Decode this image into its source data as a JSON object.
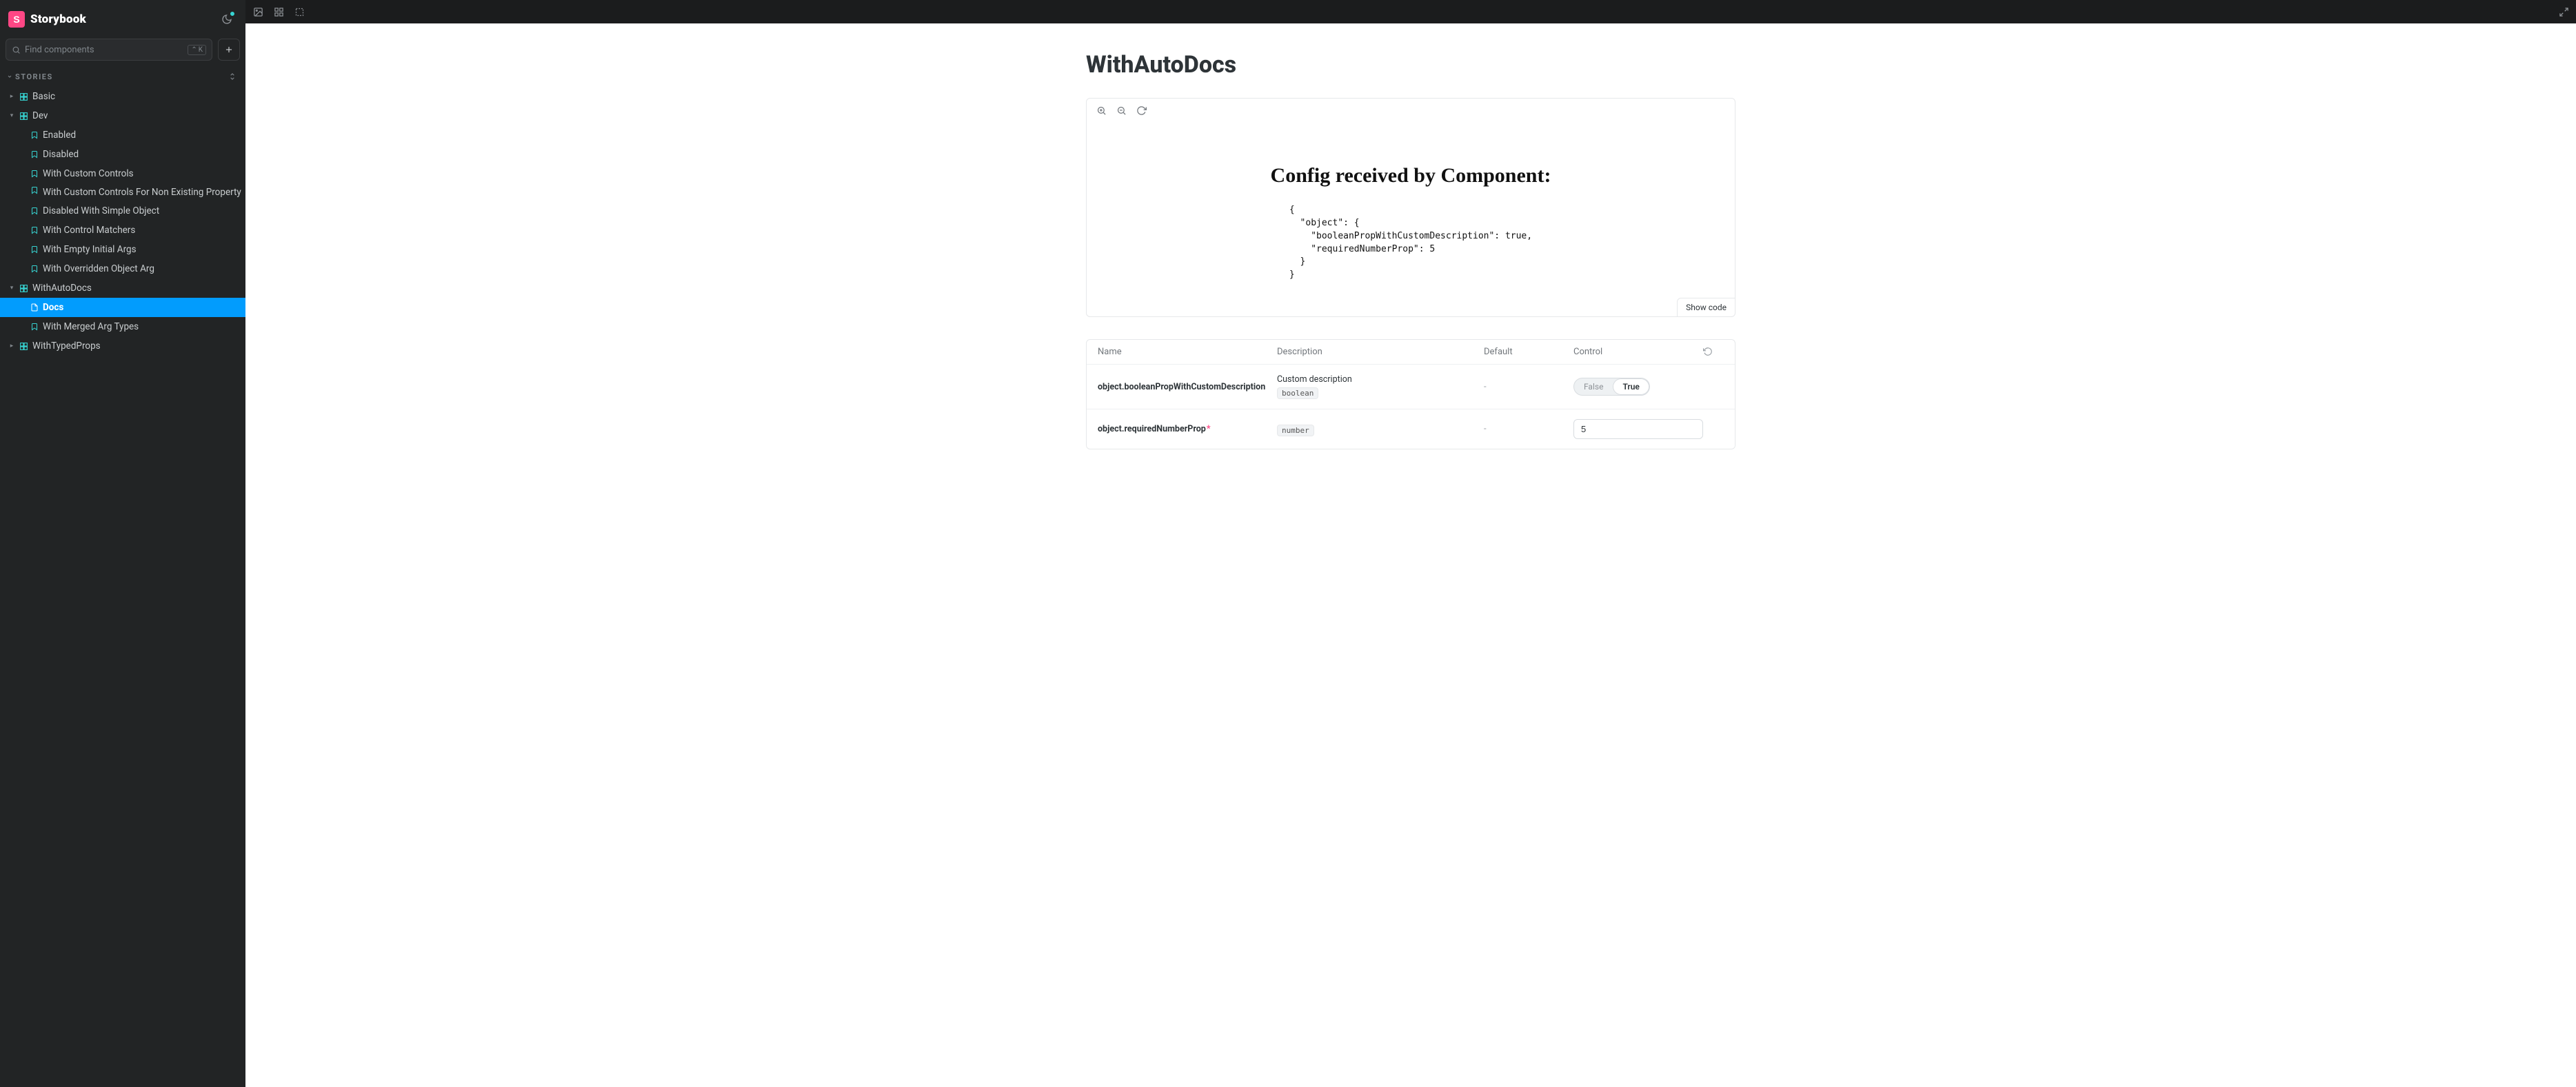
{
  "brand": {
    "logo_letter": "S",
    "name": "Storybook"
  },
  "search": {
    "placeholder": "Find components",
    "shortcut_mod": "⌃",
    "shortcut_key": "K"
  },
  "section_label": "STORIES",
  "tree": {
    "basic": "Basic",
    "dev": "Dev",
    "dev_children": {
      "enabled": "Enabled",
      "disabled": "Disabled",
      "with_custom_controls": "With Custom Controls",
      "with_custom_controls_nonexisting": "With Custom Controls For Non Existing Property",
      "disabled_simple_object": "Disabled With Simple Object",
      "with_control_matchers": "With Control Matchers",
      "with_empty_initial_args": "With Empty Initial Args",
      "with_overridden_object_arg": "With Overridden Object Arg"
    },
    "with_auto_docs": "WithAutoDocs",
    "with_auto_docs_children": {
      "docs": "Docs",
      "with_merged_arg_types": "With Merged Arg Types"
    },
    "with_typed_props": "WithTypedProps"
  },
  "page": {
    "title": "WithAutoDocs",
    "preview_heading": "Config received by Component:",
    "preview_json": "{\n  \"object\": {\n    \"booleanPropWithCustomDescription\": true,\n    \"requiredNumberProp\": 5\n  }\n}",
    "show_code_label": "Show code"
  },
  "args": {
    "headers": {
      "name": "Name",
      "description": "Description",
      "default": "Default",
      "control": "Control"
    },
    "rows": [
      {
        "name": "object.booleanPropWithCustomDescription",
        "required": false,
        "description": "Custom description",
        "type": "boolean",
        "default": "-",
        "control": {
          "kind": "boolean",
          "false_label": "False",
          "true_label": "True",
          "value": true
        }
      },
      {
        "name": "object.requiredNumberProp",
        "required": true,
        "description": "",
        "type": "number",
        "default": "-",
        "control": {
          "kind": "number",
          "value": "5"
        }
      }
    ]
  }
}
